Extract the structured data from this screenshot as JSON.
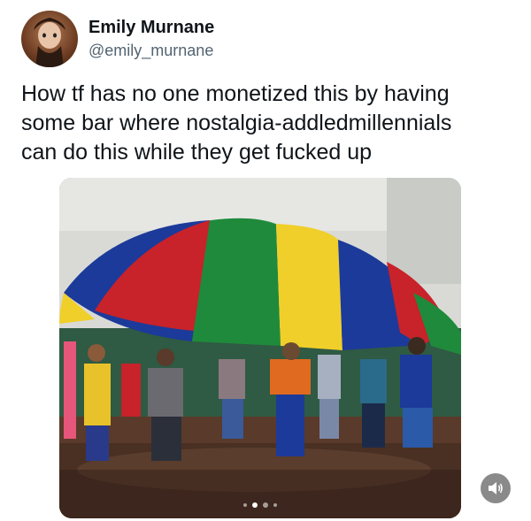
{
  "user": {
    "display_name": "Emily Murnane",
    "handle": "@emily_murnane"
  },
  "tweet": {
    "text_line1": "How tf has no one monetized this by having",
    "text_line2": "some bar where nostalgia-addledmillennials",
    "text_line3": "can do this while they get fucked up"
  },
  "media": {
    "description_icon": "parachute-photo",
    "carousel_count": 4,
    "carousel_active": 2
  },
  "controls": {
    "sound_icon": "speaker-icon"
  },
  "colors": {
    "text_primary": "#0f1419",
    "text_secondary": "#536471",
    "parachute": [
      "#1c3a9a",
      "#c8222a",
      "#1f8a3b",
      "#f0cf2a"
    ]
  }
}
